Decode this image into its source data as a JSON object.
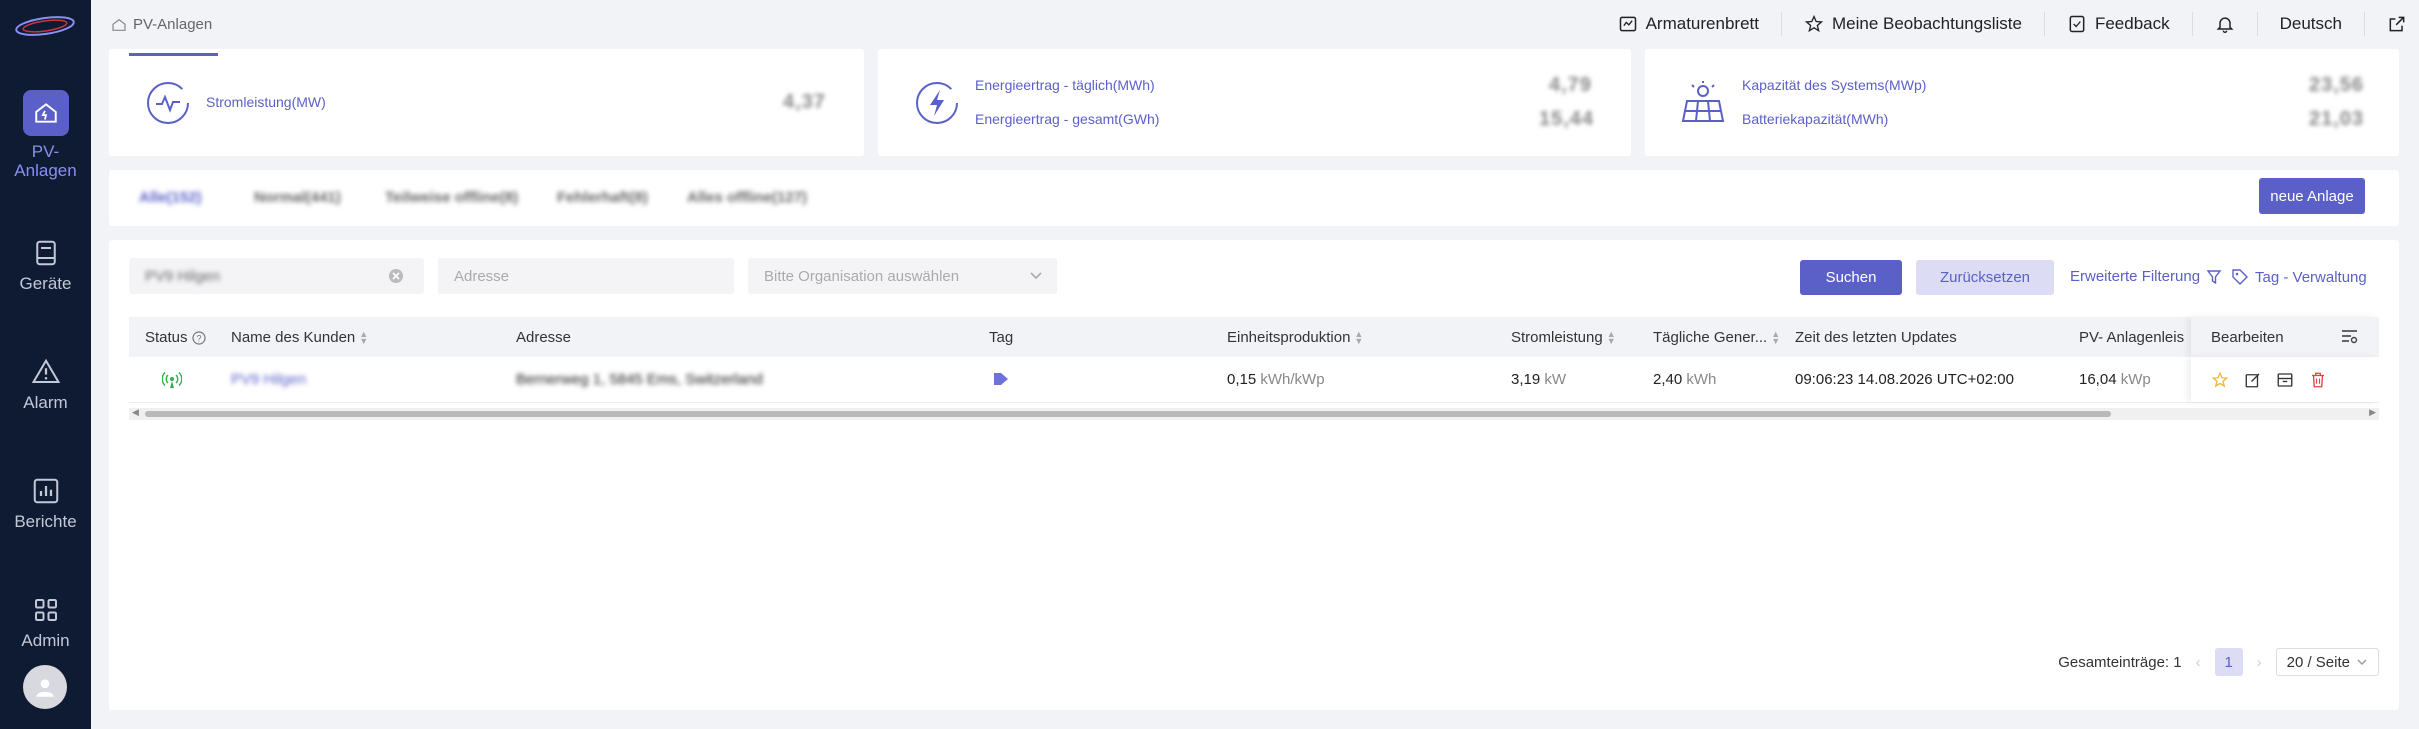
{
  "sidebar": {
    "items": [
      {
        "label": "PV-\nAnlagen",
        "icon": "home-icon"
      },
      {
        "label": "Geräte",
        "icon": "device-icon"
      },
      {
        "label": "Alarm",
        "icon": "alarm-icon"
      },
      {
        "label": "Berichte",
        "icon": "chart-icon"
      },
      {
        "label": "Admin",
        "icon": "grid-icon"
      }
    ]
  },
  "header": {
    "breadcrumb": "PV-Anlagen",
    "links": [
      "Armaturenbrett",
      "Meine Beobachtungsliste",
      "Feedback"
    ],
    "language": "Deutsch"
  },
  "stats": {
    "power_label": "Stromleistung(MW)",
    "power_value": "4,37",
    "daily_label": "Energieertrag - täglich(MWh)",
    "daily_value": "4,79",
    "total_label": "Energieertrag - gesamt(GWh)",
    "total_value": "15,44",
    "capacity_label": "Kapazität des Systems(MWp)",
    "capacity_value": "23,56",
    "battery_label": "Batteriekapazität(MWh)",
    "battery_value": "21,03"
  },
  "tabs": [
    "Alle(152)",
    "Normal(441)",
    "Teilweise offline(8)",
    "Fehlerhaft(8)",
    "Alles offline(127)"
  ],
  "new_plant_button": "neue Anlage",
  "filters": {
    "name_value": "PV9 Hilgen",
    "address_placeholder": "Adresse",
    "org_placeholder": "Bitte Organisation auswählen",
    "search_button": "Suchen",
    "reset_button": "Zurücksetzen",
    "advanced_filter": "Erweiterte Filterung",
    "tag_management": "Tag - Verwaltung"
  },
  "table": {
    "headers": [
      "Status",
      "Name des Kunden",
      "Adresse",
      "Tag",
      "Einheitsproduktion",
      "Stromleistung",
      "Tägliche Gener...",
      "Zeit des letzten Updates",
      "PV- Anlagenleis",
      "Bearbeiten"
    ],
    "row": {
      "name": "PV9 Hilgen",
      "address": "Bernerweg 1, 5845 Ems, Switzerland",
      "unit_production": "0,15",
      "unit_production_unit": "kWh/kWp",
      "power": "3,19",
      "power_unit": "kW",
      "daily": "2,40",
      "daily_unit": "kWh",
      "updated": "09:06:23 14.08.2026 UTC+02:00",
      "pv_capacity": "16,04",
      "pv_capacity_unit": "kWp"
    }
  },
  "pagination": {
    "total_label": "Gesamteinträge: 1",
    "page": "1",
    "page_size": "20 / Seite"
  },
  "colors": {
    "accent": "#5b60c8",
    "sidebar": "#0f1a33",
    "delete": "#e0453a",
    "star": "#f0b93a"
  }
}
